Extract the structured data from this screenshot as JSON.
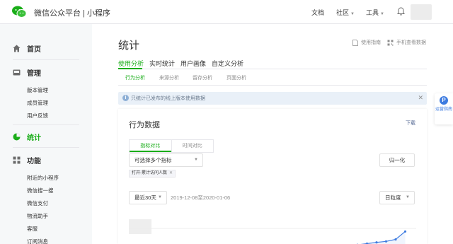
{
  "header": {
    "brand": "微信公众平台 | 小程序",
    "nav": [
      {
        "label": "文档",
        "has_caret": false
      },
      {
        "label": "社区",
        "has_caret": true
      },
      {
        "label": "工具",
        "has_caret": true
      }
    ],
    "icons": {
      "logo": "wechat-logo-icon",
      "bell": "bell-icon"
    },
    "brand_color": "#1aad19"
  },
  "sidebar": {
    "groups": [
      {
        "label": "首页",
        "icon": "home-icon",
        "active": false,
        "items": []
      },
      {
        "label": "管理",
        "icon": "inbox-icon",
        "active": false,
        "items": [
          "版本管理",
          "成员管理",
          "用户反馈"
        ]
      },
      {
        "label": "统计",
        "icon": "pie-chart-icon",
        "active": true,
        "items": []
      },
      {
        "label": "功能",
        "icon": "grid-icon",
        "active": false,
        "items": [
          "附近的小程序",
          "微信搜一搜",
          "微信支付",
          "物流助手",
          "客服",
          "订阅消息"
        ]
      }
    ]
  },
  "main": {
    "title": "统计",
    "top_links": [
      "使用指南",
      "手机查看数据"
    ],
    "tabs": [
      "使用分析",
      "实时统计",
      "用户画像",
      "自定义分析"
    ],
    "active_tab": "使用分析",
    "subtabs": [
      "行为分析",
      "来源分析",
      "留存分析",
      "页面分析"
    ],
    "active_subtab": "行为分析",
    "notice": "只统计已发布的线上版本使用数据",
    "float_guide": {
      "icon": "P",
      "label": "运营指南"
    }
  },
  "card": {
    "title": "行为数据",
    "download": "下载",
    "segments": [
      "指标对比",
      "时间对比"
    ],
    "active_segment": "指标对比",
    "metric_select": "可选择多个指标",
    "chip": "打开-累计访问人数",
    "normalize_button": "归一化",
    "range_select": "最近30天",
    "date_range": "2019-12-08至2020-01-06",
    "granularity_select": "日粒度"
  },
  "chart_data": {
    "type": "line",
    "visible_tail_values": [
      0.08,
      0.13,
      0.18,
      0.22,
      0.3,
      0.62
    ],
    "color": "#3d7be0",
    "grid": true
  }
}
